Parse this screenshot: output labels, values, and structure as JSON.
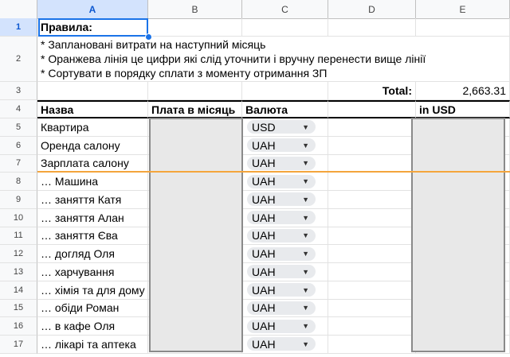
{
  "columns": [
    "A",
    "B",
    "C",
    "D",
    "E"
  ],
  "selected_column": "A",
  "rows_numbers": [
    "1",
    "2",
    "3",
    "4",
    "5",
    "6",
    "7",
    "8",
    "9",
    "10",
    "11",
    "12",
    "13",
    "14",
    "15",
    "16",
    "17"
  ],
  "rules": {
    "title": "Правила:",
    "lines": [
      "* Заплановані витрати на наступний місяць",
      "* Оранжева лінія це цифри які слід уточнити і вручну перенести вище лінії",
      "* Сортувати в порядку сплати з моменту отримання ЗП"
    ]
  },
  "total": {
    "label": "Total:",
    "value": "2,663.31"
  },
  "table_headers": {
    "name": "Назва",
    "payment": "Плата в місяць",
    "currency": "Валюта",
    "usd": "in USD"
  },
  "items": [
    {
      "name": "Квартира",
      "currency": "USD"
    },
    {
      "name": "Оренда салону",
      "currency": "UAH"
    },
    {
      "name": "Зарплата салону",
      "currency": "UAH"
    },
    {
      "name": "… Машина",
      "currency": "UAH"
    },
    {
      "name": "… заняття Катя",
      "currency": "UAH"
    },
    {
      "name": "… заняття Алан",
      "currency": "UAH"
    },
    {
      "name": "… заняття Єва",
      "currency": "UAH"
    },
    {
      "name": "… догляд Оля",
      "currency": "UAH"
    },
    {
      "name": "… харчування",
      "currency": "UAH"
    },
    {
      "name": "… хімія та для дому",
      "currency": "UAH"
    },
    {
      "name": "… обіди Роман",
      "currency": "UAH"
    },
    {
      "name": "… в кафе Оля",
      "currency": "UAH"
    },
    {
      "name": "… лікарі та аптека",
      "currency": "UAH"
    }
  ],
  "colors": {
    "accent": "#1a73e8",
    "orange_line": "#f4a53c",
    "redacted": "#e8e8e8"
  }
}
